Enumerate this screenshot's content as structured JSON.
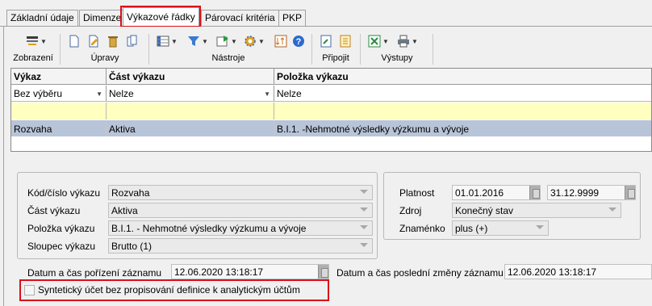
{
  "tabs": [
    {
      "label": "Základní údaje"
    },
    {
      "label": "Dimenze"
    },
    {
      "label": "Výkazové řádky"
    },
    {
      "label": "Párovací kritéria"
    },
    {
      "label": "PKP"
    }
  ],
  "toolbar": {
    "groups": {
      "zobrazeni": "Zobrazení",
      "upravy": "Úpravy",
      "nastroje": "Nástroje",
      "pripojit": "Připojit",
      "vystupy": "Výstupy"
    }
  },
  "grid": {
    "columns": [
      "Výkaz",
      "Část výkazu",
      "Položka výkazu"
    ],
    "filter": [
      "Bez výběru",
      "Nelze",
      "Nelze"
    ],
    "rows": [
      {
        "vykaz": "Rozvaha",
        "cast": "Aktiva",
        "polozka": "B.I.1. -Nehmotné výsledky výzkumu a vývoje"
      }
    ]
  },
  "detail": {
    "kod_label": "Kód/číslo výkazu",
    "kod_value": "Rozvaha",
    "cast_label": "Část výkazu",
    "cast_value": "Aktiva",
    "polozka_label": "Položka výkazu",
    "polozka_value": "B.I.1. - Nehmotné výsledky výzkumu a vývoje",
    "sloupec_label": "Sloupec výkazu",
    "sloupec_value": "Brutto (1)",
    "platnost_label": "Platnost",
    "platnost_from": "01.01.2016",
    "platnost_to": "31.12.9999",
    "zdroj_label": "Zdroj",
    "zdroj_value": "Konečný stav",
    "znamenko_label": "Znaménko",
    "znamenko_value": "plus (+)",
    "porizeni_label": "Datum a čas pořízení záznamu",
    "porizeni_value": "12.06.2020 13:18:17",
    "zmeny_label": "Datum a čas poslední změny záznamu",
    "zmeny_value": "12.06.2020 13:18:17",
    "synteticky_label": "Syntetický účet bez propisování definice k analytickým účtům",
    "synteticky_checked": false
  },
  "colors": {
    "highlight": "#d9101a",
    "selected_row": "#b8c4d8",
    "new_row": "#ffffbf"
  }
}
